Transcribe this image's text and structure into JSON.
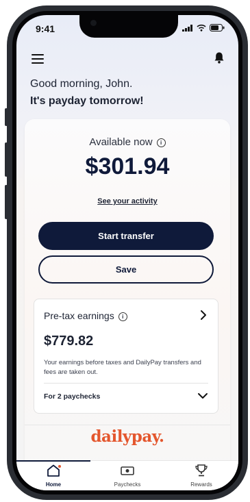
{
  "status_bar": {
    "time": "9:41"
  },
  "header": {
    "greeting": "Good morning, John.",
    "subtitle": "It's payday tomorrow!"
  },
  "balance": {
    "label": "Available now",
    "amount": "$301.94",
    "activity_link": "See your activity"
  },
  "actions": {
    "primary": "Start transfer",
    "secondary": "Save"
  },
  "earnings": {
    "title": "Pre-tax earnings",
    "amount": "$779.82",
    "description": "Your earnings before taxes and DailyPay transfers and fees are taken out.",
    "period": "For 2 paychecks"
  },
  "brand": {
    "logo": "dailypay.",
    "accent": "#e4572e",
    "primary": "#0f1a3a"
  },
  "tabs": [
    {
      "label": "Home",
      "icon": "home-icon",
      "active": true
    },
    {
      "label": "Paychecks",
      "icon": "paycheck-icon",
      "active": false
    },
    {
      "label": "Rewards",
      "icon": "trophy-icon",
      "active": false
    }
  ]
}
